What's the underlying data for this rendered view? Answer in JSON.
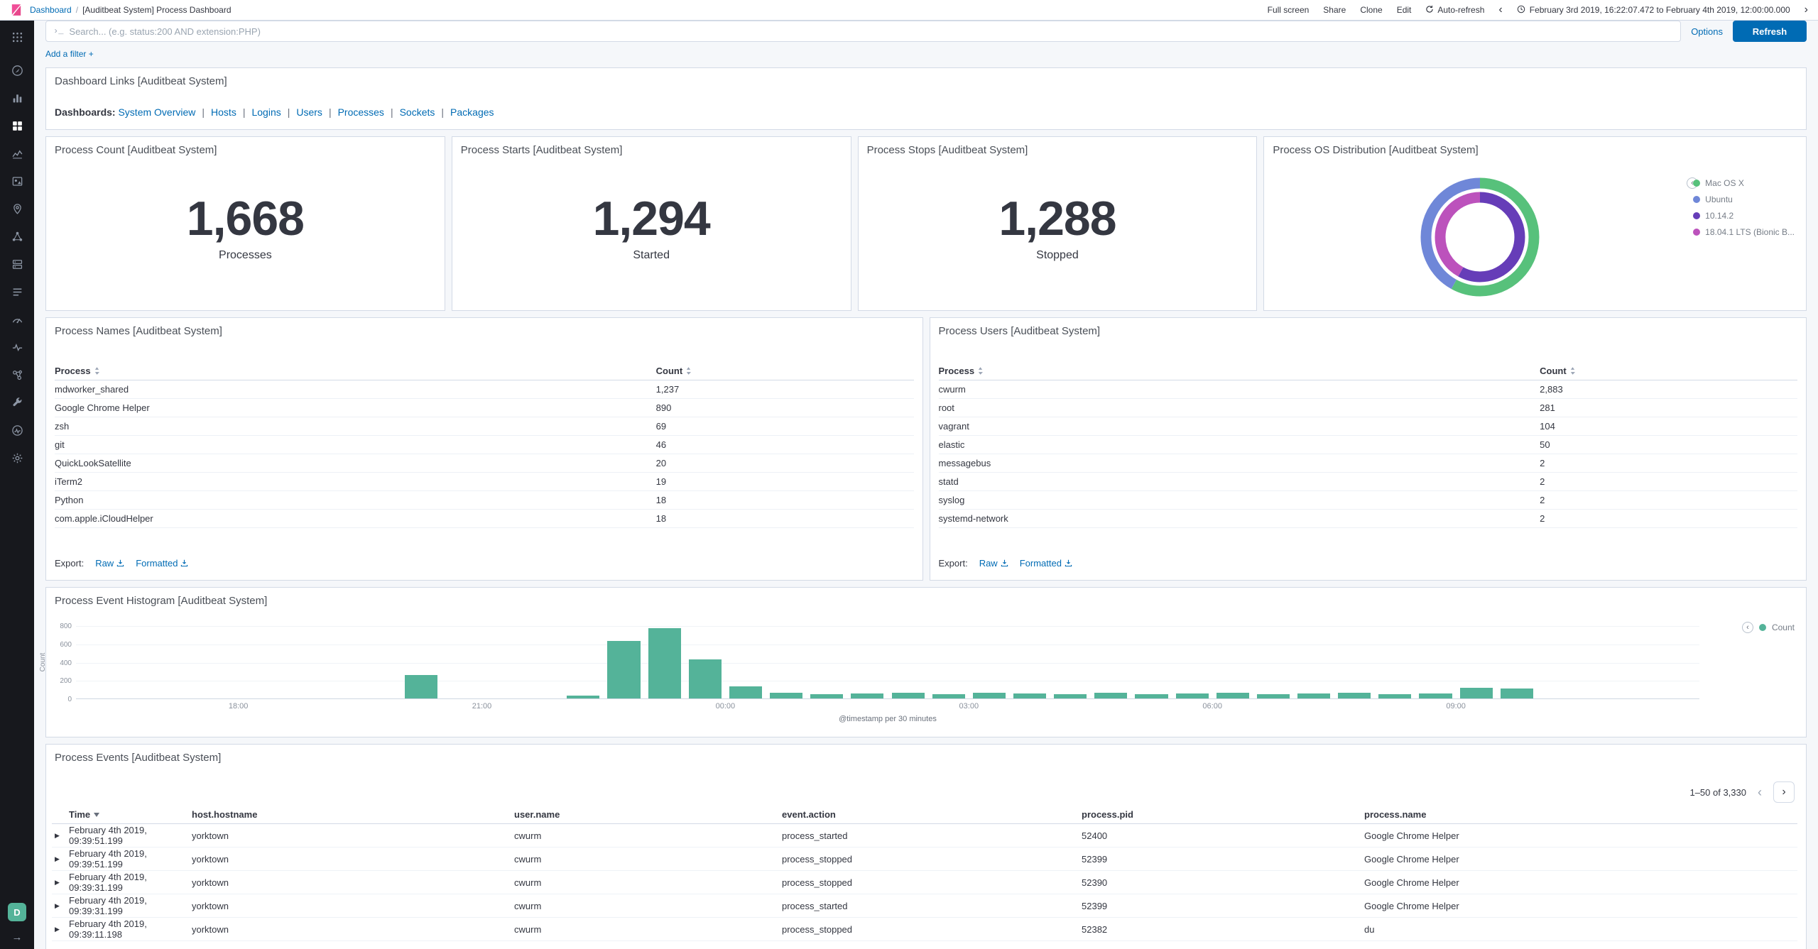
{
  "topbar": {
    "breadcrumb": {
      "root": "Dashboard",
      "separator": "/",
      "current": "[Auditbeat System] Process Dashboard"
    },
    "actions": [
      "Full screen",
      "Share",
      "Clone",
      "Edit"
    ],
    "auto_refresh": "Auto-refresh",
    "time_range": "February 3rd 2019, 16:22:07.472 to February 4th 2019, 12:00:00.000"
  },
  "query": {
    "prompt_icon": "›_",
    "placeholder": "Search... (e.g. status:200 AND extension:PHP)",
    "options": "Options",
    "refresh": "Refresh"
  },
  "filters": {
    "add_filter": "Add a filter +"
  },
  "glyphs": {
    "back": "‹",
    "forward": "›",
    "legend_toggle": "‹",
    "prev": "‹",
    "next": "›",
    "expand_row": "▶",
    "arrow_right": "→"
  },
  "sidebar": {
    "items": [
      {
        "id": "menu",
        "label": "Menu"
      },
      {
        "id": "discover",
        "label": "Discover"
      },
      {
        "id": "visualize",
        "label": "Visualize"
      },
      {
        "id": "dashboard",
        "label": "Dashboard",
        "active": true
      },
      {
        "id": "timelion",
        "label": "Timelion"
      },
      {
        "id": "canvas",
        "label": "Canvas"
      },
      {
        "id": "maps",
        "label": "Maps"
      },
      {
        "id": "machine-learning",
        "label": "Machine Learning"
      },
      {
        "id": "infrastructure",
        "label": "Infrastructure"
      },
      {
        "id": "logs",
        "label": "Logs"
      },
      {
        "id": "apm",
        "label": "APM"
      },
      {
        "id": "uptime",
        "label": "Uptime"
      },
      {
        "id": "graph",
        "label": "Graph"
      },
      {
        "id": "dev-tools",
        "label": "Dev Tools"
      },
      {
        "id": "monitoring",
        "label": "Monitoring"
      },
      {
        "id": "management",
        "label": "Management"
      }
    ],
    "space_initial": "D"
  },
  "links_panel": {
    "title": "Dashboard Links [Auditbeat System]",
    "prefix": "Dashboards",
    "links": [
      "System Overview",
      "Hosts",
      "Logins",
      "Users",
      "Processes",
      "Sockets",
      "Packages"
    ]
  },
  "metric_panels": [
    {
      "title": "Process Count [Auditbeat System]",
      "value": "1,668",
      "label": "Processes"
    },
    {
      "title": "Process Starts [Auditbeat System]",
      "value": "1,294",
      "label": "Started"
    },
    {
      "title": "Process Stops [Auditbeat System]",
      "value": "1,288",
      "label": "Stopped"
    }
  ],
  "os_panel": {
    "title": "Process OS Distribution [Auditbeat System]",
    "legend": [
      {
        "label": "Mac OS X",
        "color": "#57c17b"
      },
      {
        "label": "Ubuntu",
        "color": "#6f87d8"
      },
      {
        "label": "10.14.2",
        "color": "#663db8"
      },
      {
        "label": "18.04.1 LTS (Bionic B...",
        "color": "#bc52bc"
      }
    ]
  },
  "tables": {
    "names": {
      "title": "Process Names [Auditbeat System]",
      "columns": [
        "Process",
        "Count"
      ],
      "rows": [
        [
          "mdworker_shared",
          "1,237"
        ],
        [
          "Google Chrome Helper",
          "890"
        ],
        [
          "zsh",
          "69"
        ],
        [
          "git",
          "46"
        ],
        [
          "QuickLookSatellite",
          "20"
        ],
        [
          "iTerm2",
          "19"
        ],
        [
          "Python",
          "18"
        ],
        [
          "com.apple.iCloudHelper",
          "18"
        ]
      ],
      "export": "Export:",
      "raw": "Raw",
      "formatted": "Formatted"
    },
    "users": {
      "title": "Process Users [Auditbeat System]",
      "columns": [
        "Process",
        "Count"
      ],
      "rows": [
        [
          "cwurm",
          "2,883"
        ],
        [
          "root",
          "281"
        ],
        [
          "vagrant",
          "104"
        ],
        [
          "elastic",
          "50"
        ],
        [
          "messagebus",
          "2"
        ],
        [
          "statd",
          "2"
        ],
        [
          "syslog",
          "2"
        ],
        [
          "systemd-network",
          "2"
        ]
      ],
      "export": "Export:",
      "raw": "Raw",
      "formatted": "Formatted"
    }
  },
  "histogram_panel": {
    "title": "Process Event Histogram [Auditbeat System]",
    "legend": "Count"
  },
  "events_panel": {
    "title": "Process Events [Auditbeat System]",
    "pagination": "1–50 of 3,330",
    "columns": [
      "Time",
      "host.hostname",
      "user.name",
      "event.action",
      "process.pid",
      "process.name"
    ],
    "rows": [
      [
        "February 4th 2019, 09:39:51.199",
        "yorktown",
        "cwurm",
        "process_started",
        "52400",
        "Google Chrome Helper"
      ],
      [
        "February 4th 2019, 09:39:51.199",
        "yorktown",
        "cwurm",
        "process_stopped",
        "52399",
        "Google Chrome Helper"
      ],
      [
        "February 4th 2019, 09:39:31.199",
        "yorktown",
        "cwurm",
        "process_stopped",
        "52390",
        "Google Chrome Helper"
      ],
      [
        "February 4th 2019, 09:39:31.199",
        "yorktown",
        "cwurm",
        "process_started",
        "52399",
        "Google Chrome Helper"
      ],
      [
        "February 4th 2019, 09:39:11.198",
        "yorktown",
        "cwurm",
        "process_stopped",
        "52382",
        "du"
      ]
    ]
  },
  "chart_data": [
    {
      "type": "bar",
      "title": "Process Event Histogram [Auditbeat System]",
      "xlabel": "@timestamp per 30 minutes",
      "ylabel": "Count",
      "ylim": [
        0,
        800
      ],
      "yticks": [
        0,
        200,
        400,
        600,
        800
      ],
      "bucket_minutes": 30,
      "x": [
        "16:00",
        "16:30",
        "17:00",
        "17:30",
        "18:00",
        "18:30",
        "19:00",
        "19:30",
        "20:00",
        "20:30",
        "21:00",
        "21:30",
        "22:00",
        "22:30",
        "23:00",
        "23:30",
        "00:00",
        "00:30",
        "01:00",
        "01:30",
        "02:00",
        "02:30",
        "03:00",
        "03:30",
        "04:00",
        "04:30",
        "05:00",
        "05:30",
        "06:00",
        "06:30",
        "07:00",
        "07:30",
        "08:00",
        "08:30",
        "09:00",
        "09:30",
        "10:00",
        "10:30",
        "11:00",
        "11:30"
      ],
      "values": [
        0,
        0,
        0,
        0,
        0,
        0,
        0,
        0,
        260,
        0,
        0,
        0,
        30,
        630,
        770,
        430,
        135,
        60,
        45,
        55,
        65,
        50,
        60,
        55,
        45,
        60,
        50,
        55,
        65,
        50,
        55,
        60,
        50,
        55,
        115,
        105,
        0,
        0,
        0,
        0
      ],
      "xticks": [
        "18:00",
        "21:00",
        "00:00",
        "03:00",
        "06:00",
        "09:00"
      ],
      "bar_color": "#54b399",
      "legend": [
        "Count"
      ],
      "legend_position": "top-right",
      "grid": true
    },
    {
      "type": "pie",
      "donut": true,
      "title": "Process OS Distribution [Auditbeat System]",
      "rings": {
        "outer": [
          {
            "label": "Mac OS X",
            "value": 58,
            "color": "#57c17b"
          },
          {
            "label": "Ubuntu",
            "value": 42,
            "color": "#6f87d8"
          }
        ],
        "inner": [
          {
            "label": "10.14.2",
            "value": 58,
            "color": "#663db8"
          },
          {
            "label": "18.04.1 LTS (Bionic B...",
            "value": 42,
            "color": "#bc52bc"
          }
        ]
      },
      "legend_position": "right"
    }
  ]
}
